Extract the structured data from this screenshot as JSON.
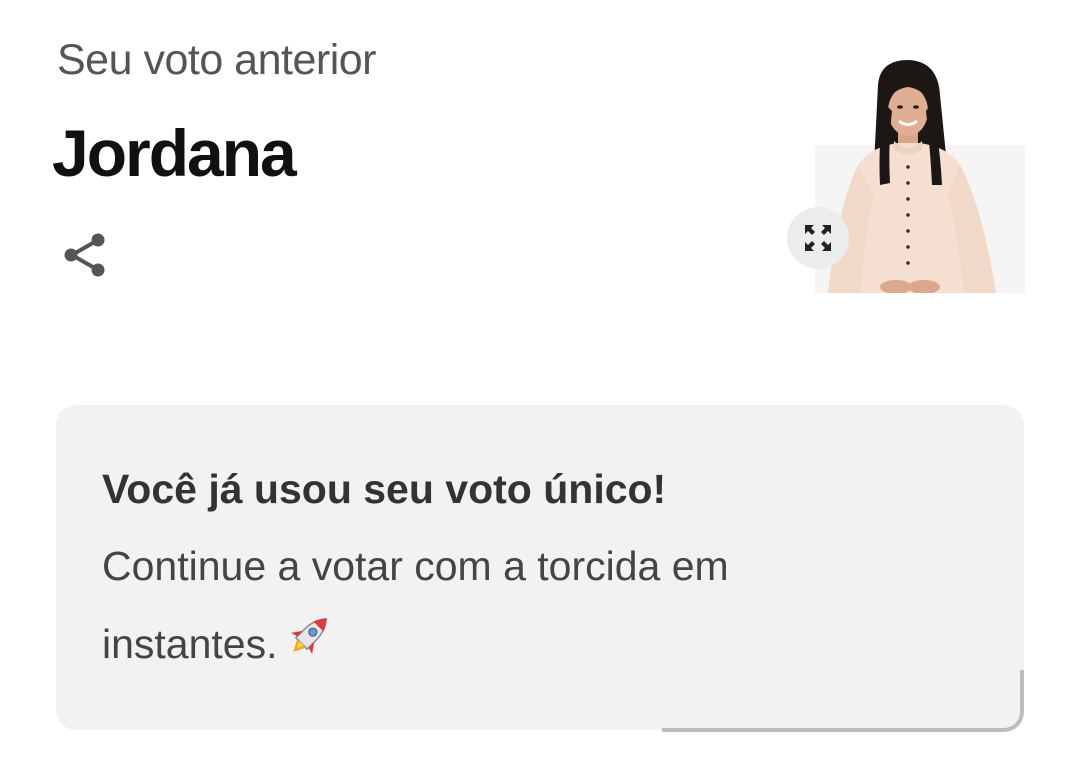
{
  "previous_vote": {
    "label": "Seu voto anterior",
    "candidate_name": "Jordana"
  },
  "icons": {
    "share": "share-icon",
    "expand": "expand-icon",
    "rocket": "rocket-icon"
  },
  "notice": {
    "title": "Você já usou seu voto único!",
    "message": "Continue a votar com a torcida em instantes."
  },
  "colors": {
    "card_background": "#f2f2f2",
    "title_text": "#111111",
    "label_text": "#555555"
  }
}
